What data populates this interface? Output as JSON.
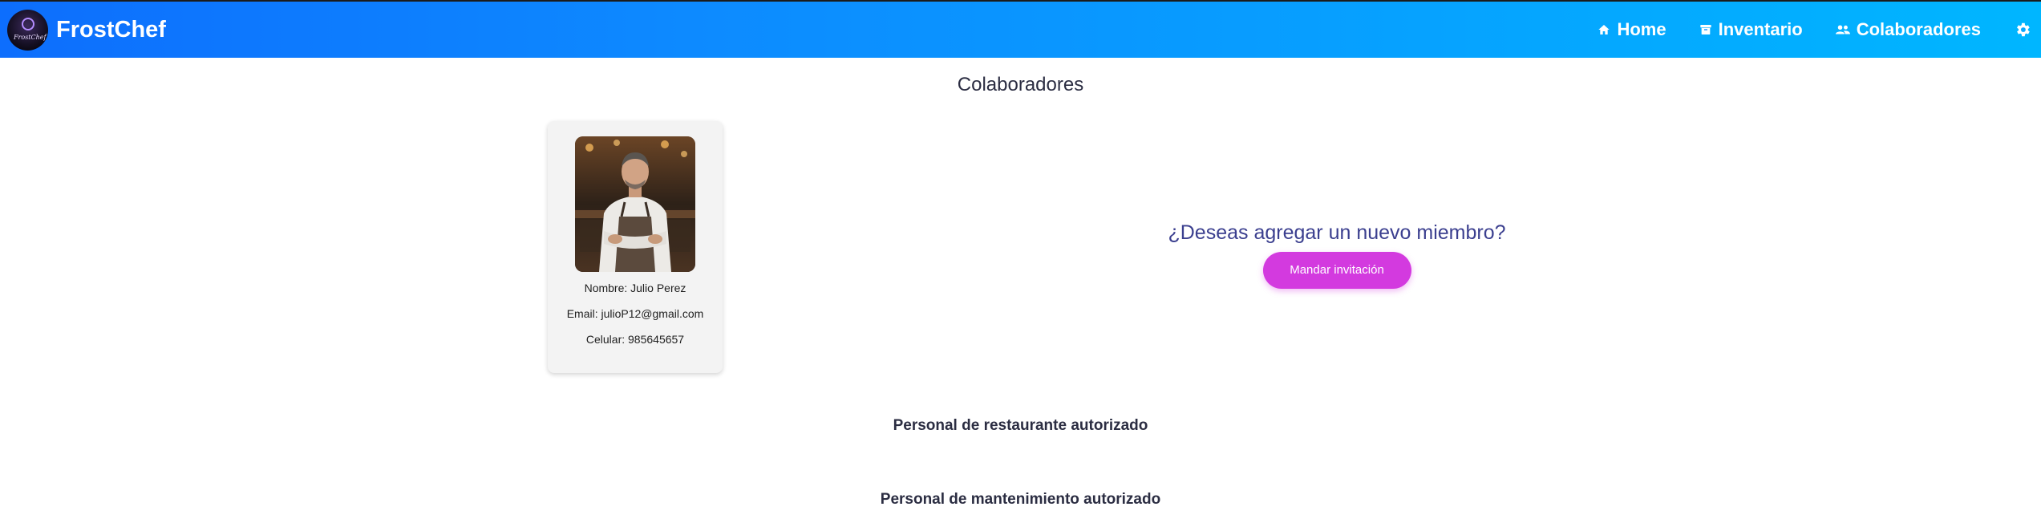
{
  "app": {
    "brand_name": "FrostChef",
    "logo_text": "FrostChef"
  },
  "nav": {
    "items": [
      {
        "label": "Home",
        "icon": "home-icon"
      },
      {
        "label": "Inventario",
        "icon": "archive-icon"
      },
      {
        "label": "Colaboradores",
        "icon": "people-icon"
      }
    ],
    "settings_icon": "gear-icon"
  },
  "main": {
    "title": "Colaboradores",
    "collaborator": {
      "name_line": "Nombre: Julio Perez",
      "email_line": "Email: julioP12@gmail.com",
      "phone_line": "Celular: 985645657"
    },
    "invite": {
      "question": "¿Deseas agregar un nuevo miembro?",
      "button_label": "Mandar invitación"
    },
    "sections": [
      {
        "heading": "Personal de restaurante autorizado"
      },
      {
        "heading": "Personal de mantenimiento autorizado"
      }
    ]
  },
  "colors": {
    "navbar_start": "#0d6efd",
    "navbar_end": "#00b6ff",
    "accent_button": "#d33adf",
    "invite_text": "#3b3f8f"
  }
}
